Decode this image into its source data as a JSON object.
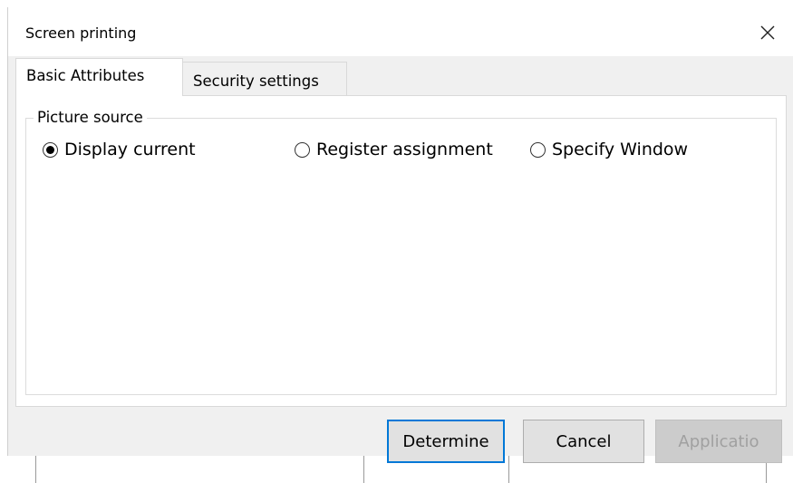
{
  "window": {
    "title": "Screen printing",
    "close_icon": "close-icon"
  },
  "tabs": [
    {
      "label": "Basic Attributes",
      "active": true
    },
    {
      "label": "Security settings",
      "active": false
    }
  ],
  "picture_source": {
    "legend": "Picture source",
    "options": [
      {
        "label": "Display current",
        "selected": true
      },
      {
        "label": "Register assignment",
        "selected": false
      },
      {
        "label": "Specify Window",
        "selected": false
      }
    ]
  },
  "buttons": {
    "determine": "Determine",
    "cancel": "Cancel",
    "apply": "Applicatio"
  },
  "colors": {
    "accent": "#0078d7",
    "dialog_bg": "#f0f0f0",
    "panel_bg": "#ffffff"
  }
}
